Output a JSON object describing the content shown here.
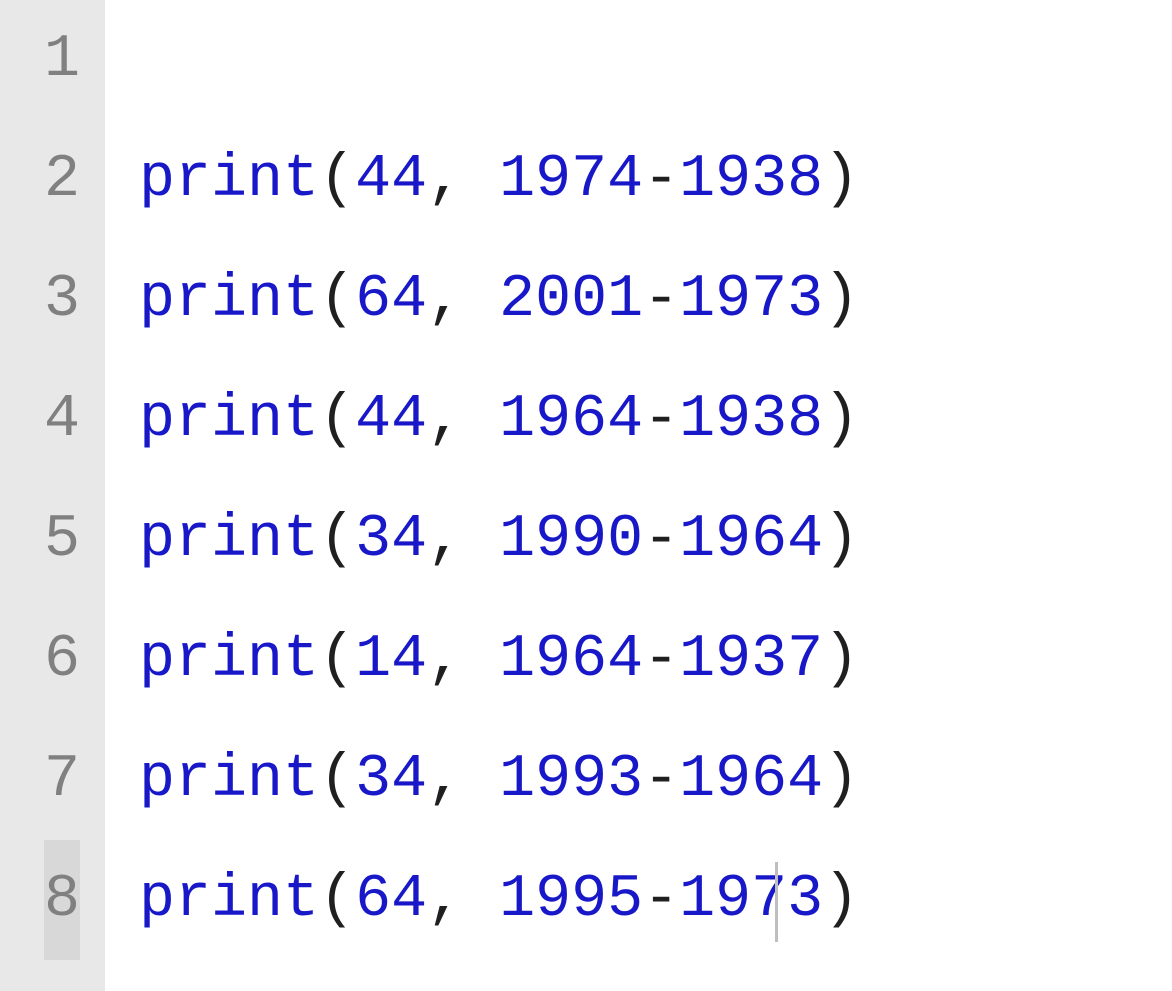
{
  "editor": {
    "gutter": [
      "1",
      "2",
      "3",
      "4",
      "5",
      "6",
      "7",
      "8"
    ],
    "current_line_index": 7,
    "lines": [
      {
        "fn": "",
        "lp": "",
        "arg1": "",
        "c": "",
        "sp": "",
        "arg2": "",
        "op": "",
        "arg3": "",
        "rp": ""
      },
      {
        "fn": "print",
        "lp": "(",
        "arg1": "44",
        "c": ",",
        "sp": " ",
        "arg2": "1974",
        "op": "-",
        "arg3": "1938",
        "rp": ")"
      },
      {
        "fn": "print",
        "lp": "(",
        "arg1": "64",
        "c": ",",
        "sp": " ",
        "arg2": "2001",
        "op": "-",
        "arg3": "1973",
        "rp": ")"
      },
      {
        "fn": "print",
        "lp": "(",
        "arg1": "44",
        "c": ",",
        "sp": " ",
        "arg2": "1964",
        "op": "-",
        "arg3": "1938",
        "rp": ")"
      },
      {
        "fn": "print",
        "lp": "(",
        "arg1": "34",
        "c": ",",
        "sp": " ",
        "arg2": "1990",
        "op": "-",
        "arg3": "1964",
        "rp": ")"
      },
      {
        "fn": "print",
        "lp": "(",
        "arg1": "14",
        "c": ",",
        "sp": " ",
        "arg2": "1964",
        "op": "-",
        "arg3": "1937",
        "rp": ")"
      },
      {
        "fn": "print",
        "lp": "(",
        "arg1": "34",
        "c": ",",
        "sp": " ",
        "arg2": "1993",
        "op": "-",
        "arg3": "1964",
        "rp": ")"
      },
      {
        "fn": "print",
        "lp": "(",
        "arg1": "64",
        "c": ",",
        "sp": " ",
        "arg2": "1995",
        "op": "-",
        "arg3": "1973",
        "rp": ")"
      }
    ]
  }
}
